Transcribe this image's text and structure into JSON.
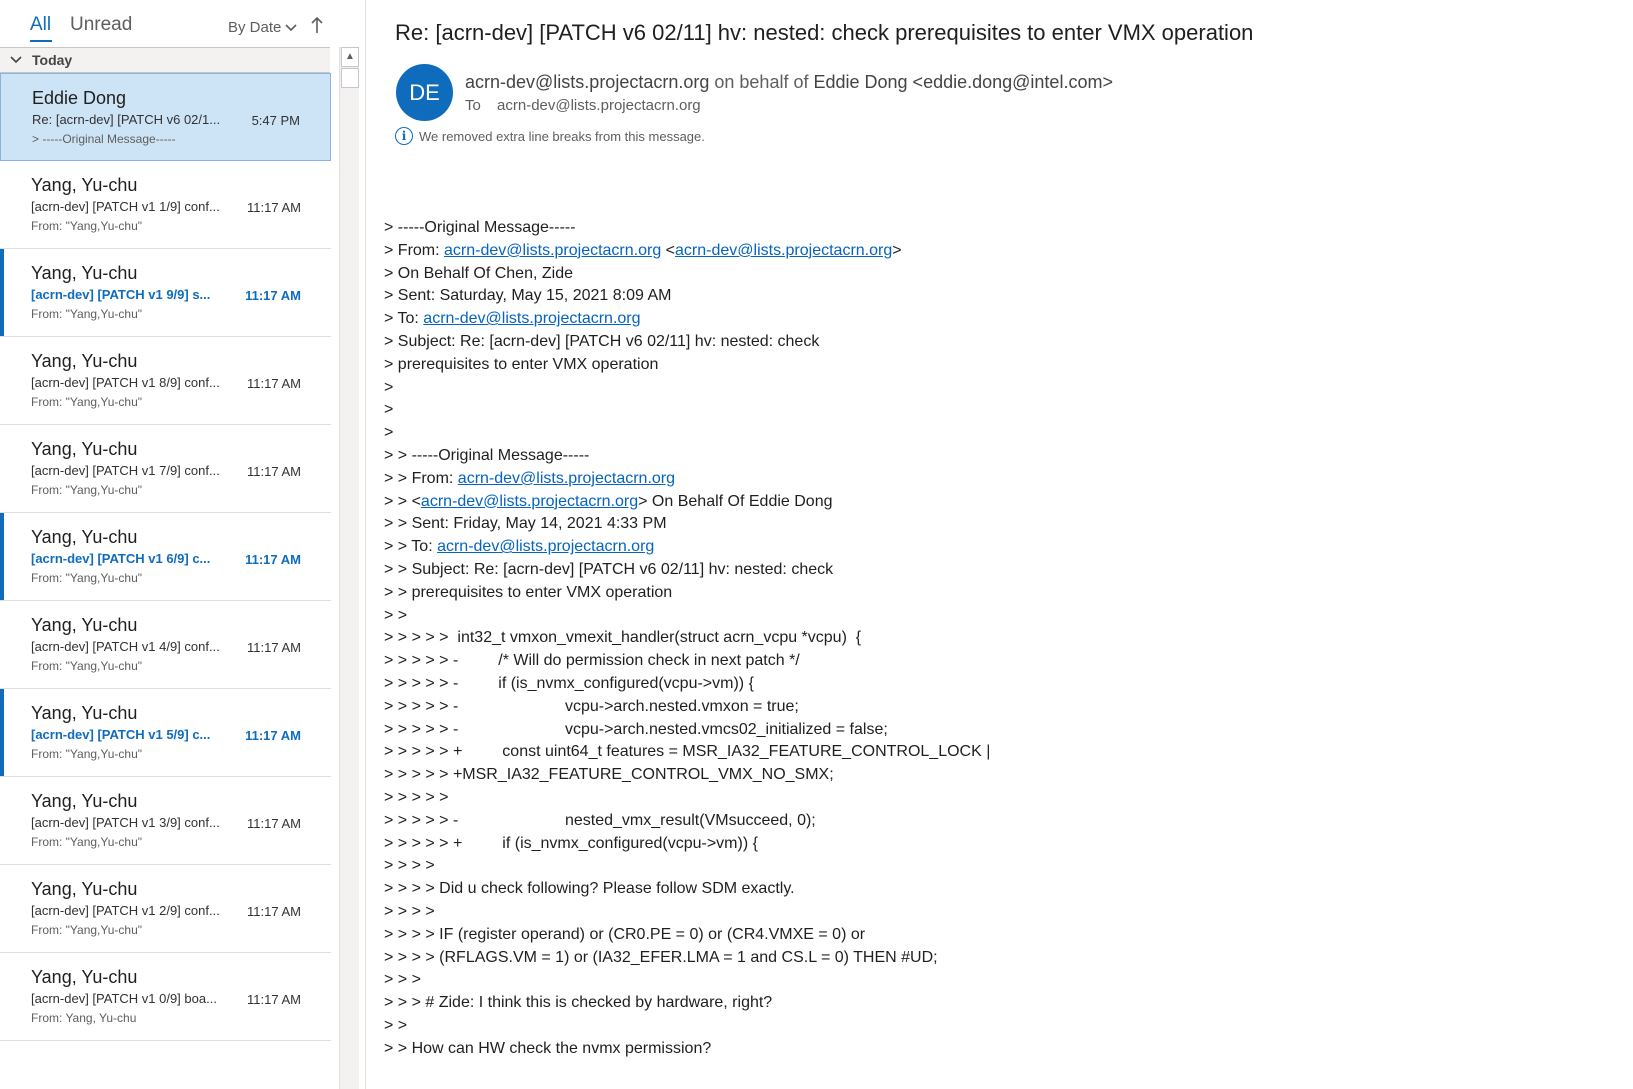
{
  "list": {
    "filter_all": "All",
    "filter_unread": "Unread",
    "sort_label": "By Date",
    "sort_icon": "chevron-down-icon",
    "sort_direction_icon": "arrow-up-icon",
    "group_label": "Today",
    "messages": [
      {
        "sender": "Eddie Dong",
        "subject": "Re: [acrn-dev] [PATCH v6 02/1...",
        "time": "5:47 PM",
        "preview": "> -----Original Message-----",
        "state": "selected"
      },
      {
        "sender": "Yang, Yu-chu",
        "subject": "[acrn-dev] [PATCH v1 1/9] conf...",
        "time": "11:17 AM",
        "preview": "From: \"Yang,Yu-chu\"",
        "state": "read"
      },
      {
        "sender": "Yang, Yu-chu",
        "subject": "[acrn-dev] [PATCH v1 9/9] s...",
        "time": "11:17 AM",
        "preview": "From: \"Yang,Yu-chu\"",
        "state": "unread"
      },
      {
        "sender": "Yang, Yu-chu",
        "subject": "[acrn-dev] [PATCH v1 8/9] conf...",
        "time": "11:17 AM",
        "preview": "From: \"Yang,Yu-chu\"",
        "state": "read"
      },
      {
        "sender": "Yang, Yu-chu",
        "subject": "[acrn-dev] [PATCH v1 7/9] conf...",
        "time": "11:17 AM",
        "preview": "From: \"Yang,Yu-chu\"",
        "state": "read"
      },
      {
        "sender": "Yang, Yu-chu",
        "subject": "[acrn-dev] [PATCH v1 6/9] c...",
        "time": "11:17 AM",
        "preview": "From: \"Yang,Yu-chu\"",
        "state": "unread"
      },
      {
        "sender": "Yang, Yu-chu",
        "subject": "[acrn-dev] [PATCH v1 4/9] conf...",
        "time": "11:17 AM",
        "preview": "From: \"Yang,Yu-chu\"",
        "state": "read"
      },
      {
        "sender": "Yang, Yu-chu",
        "subject": "[acrn-dev] [PATCH v1 5/9] c...",
        "time": "11:17 AM",
        "preview": "From: \"Yang,Yu-chu\"",
        "state": "unread"
      },
      {
        "sender": "Yang, Yu-chu",
        "subject": "[acrn-dev] [PATCH v1 3/9] conf...",
        "time": "11:17 AM",
        "preview": "From: \"Yang,Yu-chu\"",
        "state": "read"
      },
      {
        "sender": "Yang, Yu-chu",
        "subject": "[acrn-dev] [PATCH v1 2/9] conf...",
        "time": "11:17 AM",
        "preview": "From: \"Yang,Yu-chu\"",
        "state": "read"
      },
      {
        "sender": "Yang, Yu-chu",
        "subject": "[acrn-dev] [PATCH v1 0/9] boa...",
        "time": "11:17 AM",
        "preview": "From: Yang, Yu-chu",
        "state": "read"
      }
    ]
  },
  "mail": {
    "subject": "Re: [acrn-dev] [PATCH v6 02/11] hv: nested: check prerequisites to enter VMX operation",
    "avatar_initials": "DE",
    "avatar_color": "#0f6cbd",
    "from_address": "acrn-dev@lists.projectacrn.org",
    "on_behalf_text": "on behalf of",
    "sender_name": "Eddie Dong <eddie.dong@intel.com>",
    "to_label": "To",
    "to_address": "acrn-dev@lists.projectacrn.org",
    "info_icon": "info-icon",
    "info_text": "We removed extra line breaks from this message.",
    "body_lines": [
      [
        {
          "t": "> -----Original Message-----"
        }
      ],
      [
        {
          "t": "> From: "
        },
        {
          "t": "acrn-dev@lists.projectacrn.org",
          "link": true
        },
        {
          "t": " <"
        },
        {
          "t": "acrn-dev@lists.projectacrn.org",
          "link": true
        },
        {
          "t": ">"
        }
      ],
      [
        {
          "t": "> On Behalf Of Chen, Zide"
        }
      ],
      [
        {
          "t": "> Sent: Saturday, May 15, 2021 8:09 AM"
        }
      ],
      [
        {
          "t": "> To: "
        },
        {
          "t": "acrn-dev@lists.projectacrn.org",
          "link": true
        }
      ],
      [
        {
          "t": "> Subject: Re: [acrn-dev] [PATCH v6 02/11] hv: nested: check"
        }
      ],
      [
        {
          "t": "> prerequisites to enter VMX operation"
        }
      ],
      [
        {
          "t": ">"
        }
      ],
      [
        {
          "t": ">"
        }
      ],
      [
        {
          "t": ">"
        }
      ],
      [
        {
          "t": "> > -----Original Message-----"
        }
      ],
      [
        {
          "t": "> > From: "
        },
        {
          "t": "acrn-dev@lists.projectacrn.org",
          "link": true
        }
      ],
      [
        {
          "t": "> > <"
        },
        {
          "t": "acrn-dev@lists.projectacrn.org",
          "link": true
        },
        {
          "t": "> On Behalf Of Eddie Dong"
        }
      ],
      [
        {
          "t": "> > Sent: Friday, May 14, 2021 4:33 PM"
        }
      ],
      [
        {
          "t": "> > To: "
        },
        {
          "t": "acrn-dev@lists.projectacrn.org",
          "link": true
        }
      ],
      [
        {
          "t": "> > Subject: Re: [acrn-dev] [PATCH v6 02/11] hv: nested: check"
        }
      ],
      [
        {
          "t": "> > prerequisites to enter VMX operation"
        }
      ],
      [
        {
          "t": "> >"
        }
      ],
      [
        {
          "t": "> > > > >  int32_t vmxon_vmexit_handler(struct acrn_vcpu *vcpu)  {"
        }
      ],
      [
        {
          "t": "> > > > > -         /* Will do permission check in next patch */"
        }
      ],
      [
        {
          "t": "> > > > > -         if (is_nvmx_configured(vcpu->vm)) {"
        }
      ],
      [
        {
          "t": "> > > > > -                        vcpu->arch.nested.vmxon = true;"
        }
      ],
      [
        {
          "t": "> > > > > -                        vcpu->arch.nested.vmcs02_initialized = false;"
        }
      ],
      [
        {
          "t": "> > > > > +         const uint64_t features = MSR_IA32_FEATURE_CONTROL_LOCK |"
        }
      ],
      [
        {
          "t": "> > > > > +MSR_IA32_FEATURE_CONTROL_VMX_NO_SMX;"
        }
      ],
      [
        {
          "t": "> > > > >"
        }
      ],
      [
        {
          "t": "> > > > > -                        nested_vmx_result(VMsucceed, 0);"
        }
      ],
      [
        {
          "t": "> > > > > +         if (is_nvmx_configured(vcpu->vm)) {"
        }
      ],
      [
        {
          "t": "> > > >"
        }
      ],
      [
        {
          "t": "> > > > Did u check following? Please follow SDM exactly."
        }
      ],
      [
        {
          "t": "> > > >"
        }
      ],
      [
        {
          "t": "> > > > IF (register operand) or (CR0.PE = 0) or (CR4.VMXE = 0) or"
        }
      ],
      [
        {
          "t": "> > > > (RFLAGS.VM = 1) or (IA32_EFER.LMA = 1 and CS.L = 0) THEN #UD;"
        }
      ],
      [
        {
          "t": "> > >"
        }
      ],
      [
        {
          "t": "> > > # Zide: I think this is checked by hardware, right?"
        }
      ],
      [
        {
          "t": "> >"
        }
      ],
      [
        {
          "t": "> > How can HW check the nvmx permission?"
        }
      ]
    ]
  }
}
